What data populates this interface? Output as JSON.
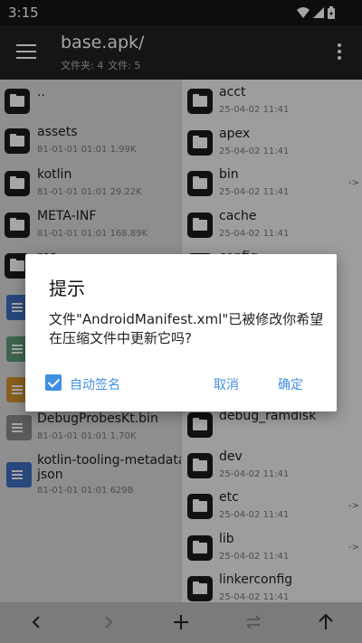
{
  "status_bar": {
    "time": "3:15"
  },
  "toolbar": {
    "title": "base.apk/",
    "subtitle_folders": "文件夹: 4",
    "subtitle_files": "文件: 5"
  },
  "left_pane": {
    "items": [
      {
        "name": "..",
        "meta": "",
        "type": "folder"
      },
      {
        "name": "assets",
        "meta": "81-01-01 01:01  1.99K",
        "type": "folder"
      },
      {
        "name": "kotlin",
        "meta": "81-01-01 01:01  29.22K",
        "type": "folder"
      },
      {
        "name": "META-INF",
        "meta": "81-01-01 01:01  168.89K",
        "type": "folder"
      },
      {
        "name": "res",
        "meta": "",
        "type": "folder"
      },
      {
        "name": "",
        "meta": "",
        "type": "file-blue"
      },
      {
        "name": "",
        "meta": "",
        "type": "file-green"
      },
      {
        "name": "",
        "meta": "",
        "type": "file-orange"
      },
      {
        "name": "DebugProbesKt.bin",
        "meta": "81-01-01 01:01  1.70K",
        "type": "file-gray"
      },
      {
        "name": "kotlin-tooling-metadata.",
        "name2": "json",
        "meta": "81-01-01 01:01  629B",
        "type": "file-blue"
      }
    ]
  },
  "right_pane": {
    "items": [
      {
        "name": "acct",
        "meta": "25-04-02 11:41"
      },
      {
        "name": "apex",
        "meta": "25-04-02 11:41"
      },
      {
        "name": "bin",
        "meta": "25-04-02 11:41",
        "arrow": "->"
      },
      {
        "name": "cache",
        "meta": "25-04-02 11:41"
      },
      {
        "name": "config",
        "meta": ""
      },
      {
        "name": "",
        "meta": ""
      },
      {
        "name": "",
        "meta": ""
      },
      {
        "name": "",
        "meta": ""
      },
      {
        "name": "debug_ramdisk",
        "meta": ""
      },
      {
        "name": "dev",
        "meta": "25-04-02 11:41"
      },
      {
        "name": "etc",
        "meta": "25-04-02 11:41",
        "arrow": "->"
      },
      {
        "name": "lib",
        "meta": "25-04-02 11:41",
        "arrow": "->"
      },
      {
        "name": "linkerconfig",
        "meta": "25-04-02 11:41"
      }
    ]
  },
  "dialog": {
    "title": "提示",
    "message": "文件\"AndroidManifest.xml\"已被修改你希望在压缩文件中更新它吗?",
    "checkbox_label": "自动签名",
    "checkbox_checked": true,
    "cancel_label": "取消",
    "ok_label": "确定"
  },
  "colors": {
    "accent": "#3f8fe3",
    "toolbar": "#212121",
    "bottom_bar": "#bdbdbd"
  },
  "bottom_bar": {
    "icons": [
      "back-icon",
      "forward-icon",
      "add-icon",
      "swap-icon",
      "up-arrow-icon"
    ]
  }
}
